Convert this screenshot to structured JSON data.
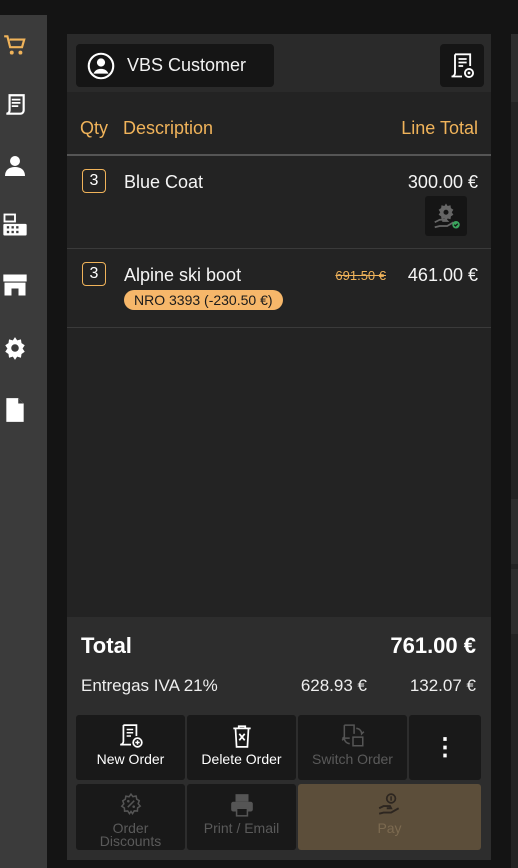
{
  "sidebar": {
    "items": [
      {
        "icon": "cart-icon"
      },
      {
        "icon": "receipt-icon"
      },
      {
        "icon": "user-icon"
      },
      {
        "icon": "cash-register-icon"
      },
      {
        "icon": "store-icon"
      },
      {
        "icon": "gear-icon"
      },
      {
        "icon": "document-icon"
      }
    ],
    "accent": "#f0b35a"
  },
  "header": {
    "customer_label": "VBS Customer",
    "config_icon": "receipt-settings-icon"
  },
  "columns": {
    "qty": "Qty",
    "description": "Description",
    "line_total": "Line Total"
  },
  "lines": [
    {
      "qty": "3",
      "description": "Blue Coat",
      "line_total": "300.00 €",
      "badge_icon": "service-gear-icon"
    },
    {
      "qty": "3",
      "description": "Alpine ski boot",
      "original_price": "691.50 €",
      "line_total": "461.00 €",
      "discount": "NRO 3393 (-230.50 €)"
    }
  ],
  "summary": {
    "total_label": "Total",
    "total_value": "761.00 €",
    "tax_label": "Entregas IVA 21%",
    "tax_base": "628.93 €",
    "tax_amount": "132.07 €"
  },
  "actions": {
    "new_order": "New Order",
    "delete_order": "Delete Order",
    "switch_order": "Switch Order",
    "more": "⋮",
    "order_discounts": "Order Discounts",
    "print_email": "Print / Email",
    "pay": "Pay"
  }
}
